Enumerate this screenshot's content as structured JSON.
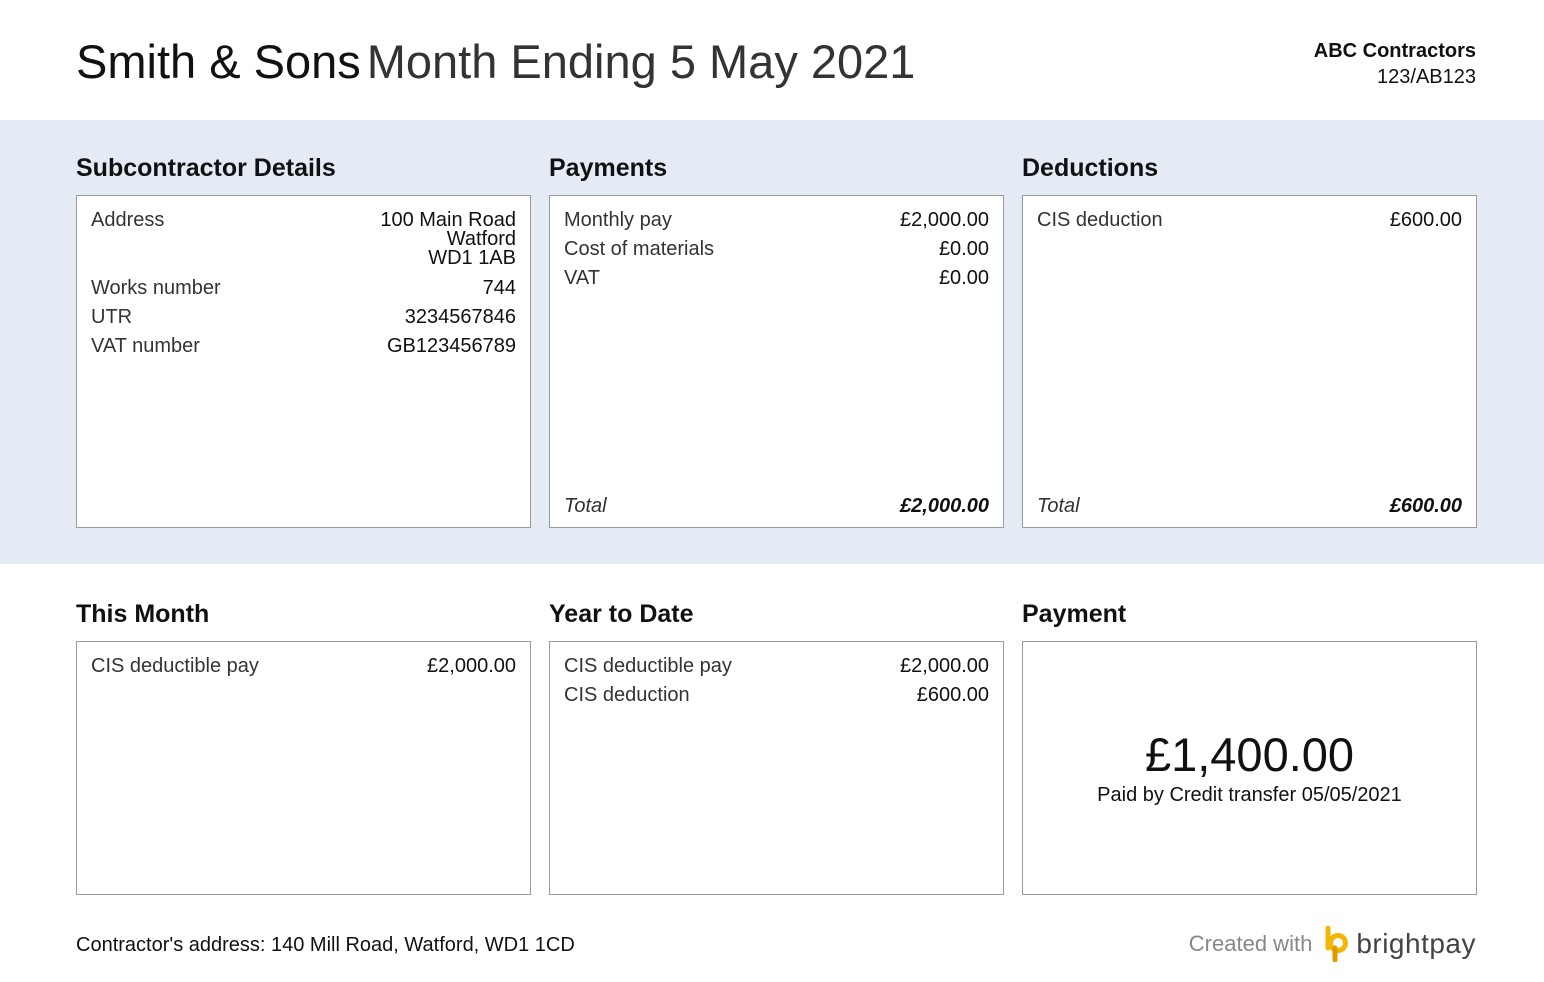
{
  "header": {
    "employer": "Smith & Sons",
    "period": "Month Ending 5 May 2021",
    "contractor_name": "ABC Contractors",
    "contractor_ref": "123/AB123"
  },
  "subcontractor": {
    "heading": "Subcontractor Details",
    "address_label": "Address",
    "address_lines": [
      "100 Main Road",
      "Watford",
      "WD1 1AB"
    ],
    "works_number_label": "Works number",
    "works_number": "744",
    "utr_label": "UTR",
    "utr": "3234567846",
    "vat_label": "VAT number",
    "vat": "GB123456789"
  },
  "payments": {
    "heading": "Payments",
    "rows": [
      {
        "label": "Monthly pay",
        "value": "£2,000.00"
      },
      {
        "label": "Cost of materials",
        "value": "£0.00"
      },
      {
        "label": "VAT",
        "value": "£0.00"
      }
    ],
    "total_label": "Total",
    "total_value": "£2,000.00"
  },
  "deductions": {
    "heading": "Deductions",
    "rows": [
      {
        "label": "CIS deduction",
        "value": "£600.00"
      }
    ],
    "total_label": "Total",
    "total_value": "£600.00"
  },
  "this_month": {
    "heading": "This Month",
    "rows": [
      {
        "label": "CIS deductible pay",
        "value": "£2,000.00"
      }
    ]
  },
  "year_to_date": {
    "heading": "Year to Date",
    "rows": [
      {
        "label": "CIS deductible pay",
        "value": "£2,000.00"
      },
      {
        "label": "CIS deduction",
        "value": "£600.00"
      }
    ]
  },
  "payment": {
    "heading": "Payment",
    "amount": "£1,400.00",
    "note": "Paid by Credit transfer 05/05/2021"
  },
  "footer": {
    "contractor_address": "Contractor's address: 140 Mill Road, Watford, WD1 1CD",
    "created_with": "Created with",
    "brand": "brightpay",
    "brand_icon": "brightpay-logo-icon"
  },
  "colors": {
    "band": "#e5ebf5",
    "border": "#9a9a9a",
    "logo_yellow": "#f2b705"
  }
}
